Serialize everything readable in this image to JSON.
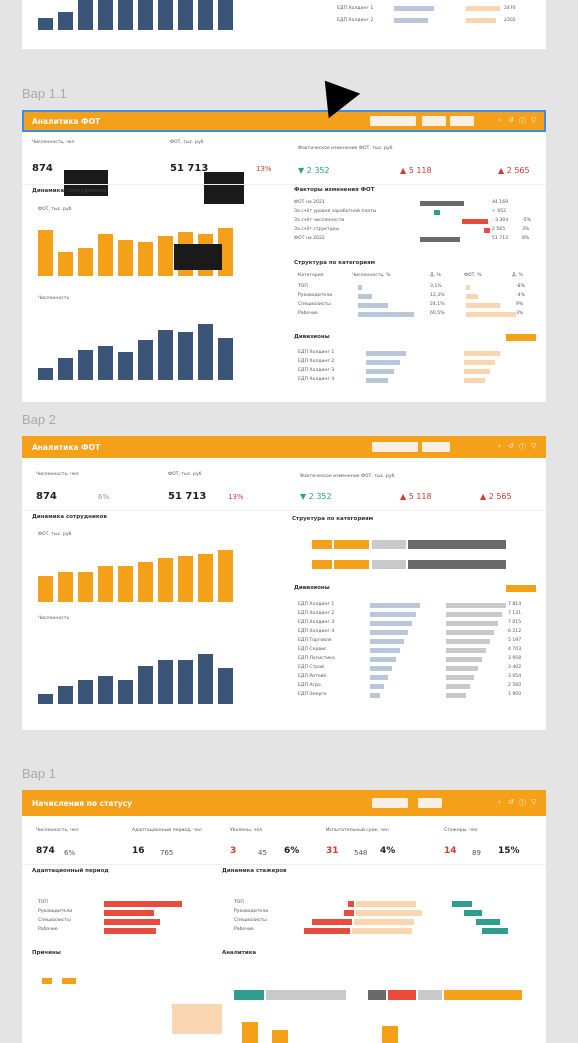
{
  "sections": {
    "v11": "Вар 1.1",
    "v2": "Вар 2",
    "v1": "Вар 1"
  },
  "v11": {
    "header": "Аналитика ФОТ",
    "kpis": {
      "headcount_label": "Численность, чел",
      "headcount": "874",
      "fot_label": "ФОТ, тыс. руб",
      "fot": "51 713",
      "fot_delta": "13%",
      "dev_label": "Фактическое изменение ФОТ, тыс. руб",
      "dev1": "▼ 2 352",
      "dev2": "▲ 5 118",
      "dev3": "▲ 2 565"
    },
    "dyn_title": "Динамика сотрудников",
    "fot_chart": "ФОТ, тыс. руб",
    "hc_chart": "Численность",
    "factors_title": "Факторы изменения ФОТ",
    "factors": [
      "ФОТ на 2021",
      "За счёт уровня заработной платы",
      "За счёт численности",
      "За счёт структуры",
      "ФОТ на 2022"
    ],
    "factor_vals": [
      "44 169",
      "+ 952",
      "- 3 304",
      "2 565",
      "51 713"
    ],
    "factor_pct": [
      "",
      "",
      "-5%",
      "3%",
      "8%"
    ],
    "struct_title": "Структура по категориям",
    "struct_head": [
      "Категория",
      "Численность, %",
      "Д, %",
      "ФОТ, %",
      "Д, %"
    ],
    "struct_rows": [
      [
        "ТОП",
        "",
        "3,1%",
        "",
        "-8%"
      ],
      [
        "Руководители",
        "",
        "12,3%",
        "",
        "-4%"
      ],
      [
        "Специалисты",
        "",
        "24,1%",
        "",
        "9%"
      ],
      [
        "Рабочие",
        "",
        "60,5%",
        "",
        "3%"
      ]
    ],
    "div_title": "Дивизионы",
    "div_rows": [
      "ЕДП Холдинг 1",
      "ЕДП Холдинг 2",
      "ЕДП Холдинг 3",
      "ЕДП Холдинг 4"
    ]
  },
  "v2": {
    "header": "Аналитика ФОТ",
    "kpis": {
      "hc_label": "Численность, чел",
      "hc": "874",
      "hc_delta": "6%",
      "fot_label": "ФОТ, тыс. руб",
      "fot": "51 713",
      "fot_delta": "13%",
      "dev_label": "Фактическое изменение ФОТ, тыс. руб",
      "dev1": "▼ 2 352",
      "dev2": "▲ 5 118",
      "dev3": "▲ 2 565"
    },
    "dyn_title": "Динамика сотрудников",
    "fot_chart": "ФОТ, тыс. руб",
    "hc_chart": "Численность",
    "struct_title": "Структура по категориям",
    "div_title": "Дивизионы",
    "div_rows": [
      "ЕДП Холдинг 1",
      "ЕДП Холдинг 2",
      "ЕДП Холдинг 3",
      "ЕДП Холдинг 4",
      "ЕДП Торговля",
      "ЕДП Сервис",
      "ЕДП Логистика",
      "ЕДП Строй",
      "ЕДП Ритейл",
      "ЕДП Агро",
      "ЕДП Энерго"
    ],
    "div_vals": [
      "7 814",
      "7 131",
      "7 015",
      "6 212",
      "5 197",
      "4 703",
      "3 958",
      "3 402",
      "3 054",
      "2 560",
      "1 900"
    ]
  },
  "v1": {
    "header": "Начисления по статусу",
    "kpis": [
      {
        "label": "Численность, чел",
        "a": "874",
        "b": "6%"
      },
      {
        "label": "Адаптационный период, чел",
        "a": "16",
        "b": "765"
      },
      {
        "label": "Уволены, чел",
        "a": "3",
        "b": "45",
        "c": "6%"
      },
      {
        "label": "Испытательный срок, чел",
        "a": "31",
        "b": "548",
        "c": "4%"
      },
      {
        "label": "Стажеры, чел",
        "a": "14",
        "b": "89",
        "c": "15%"
      }
    ],
    "adapt_title": "Адаптационный период",
    "dyn_title": "Динамика стажеров",
    "cats": [
      "ТОП",
      "Руководители",
      "Специалисты",
      "Рабочие"
    ],
    "reasons_title": "Причины",
    "plan_title": "Аналитика"
  },
  "top_partial": {
    "rows": [
      "ЕДП Холдинг 1",
      "ЕДП Холдинг 2"
    ],
    "vals": [
      "2476",
      "2302"
    ]
  },
  "colors": {
    "accent": "#f5a019",
    "navy": "#3b5578",
    "teal": "#2e9e8e",
    "red": "#e84c3d"
  }
}
